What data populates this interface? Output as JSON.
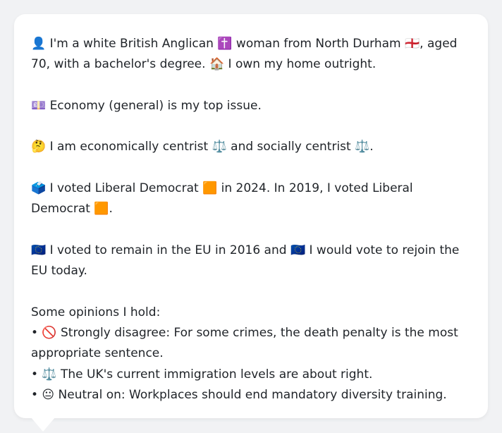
{
  "profile": {
    "line1": "👤 I'm a white British Anglican ✝️ woman from North Durham 🏴󠁧󠁢󠁥󠁮󠁧󠁿, aged 70, with a bachelor's degree. 🏠 I own my home outright.",
    "line2": "💷 Economy (general) is my top issue.",
    "line3": "🤔 I am economically centrist ⚖️ and socially centrist ⚖️.",
    "line4": "🗳️ I voted Liberal Democrat 🟧 in 2024. In 2019, I voted Liberal Democrat 🟧.",
    "line5": "🇪🇺 I voted to remain in the EU in 2016 and 🇪🇺 I would vote to rejoin the EU today."
  },
  "opinions": {
    "heading": "Some opinions I hold:",
    "items": [
      "• 🚫 Strongly disagree: For some crimes, the death penalty is the most appropriate sentence.",
      "• ⚖️ The UK's current immigration levels are about right.",
      "• 😐 Neutral on: Workplaces should end mandatory diversity training."
    ]
  }
}
